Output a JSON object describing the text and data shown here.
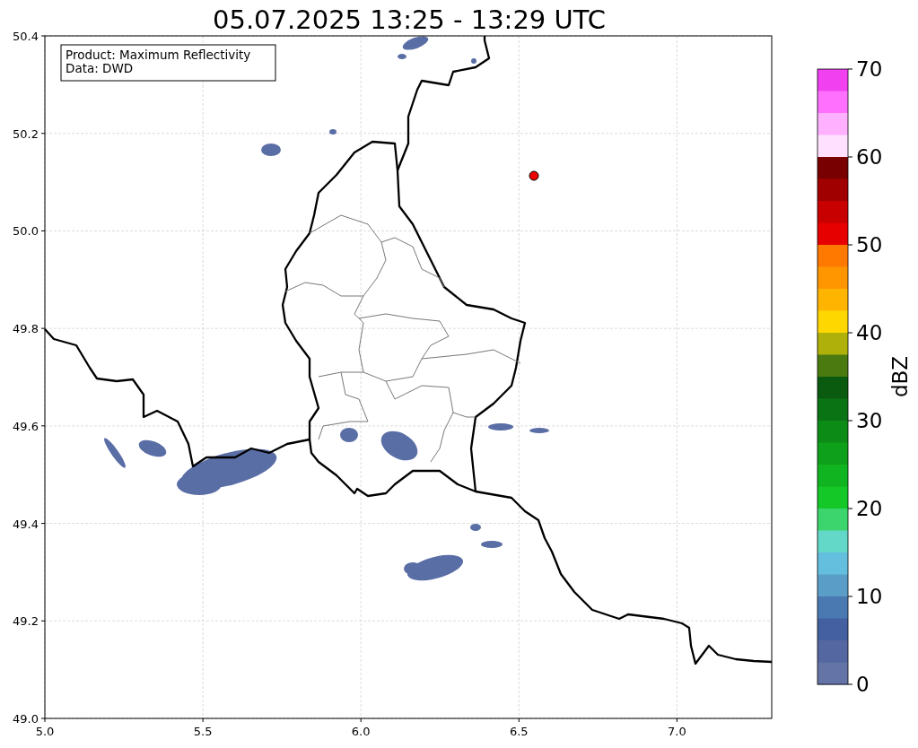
{
  "title": "05.07.2025 13:25 - 13:29 UTC",
  "info_box": {
    "lines": [
      "Product: Maximum Reflectivity",
      "Data: DWD"
    ]
  },
  "map": {
    "x_ticks": [
      "5.0",
      "5.5",
      "6.0",
      "6.5",
      "7.0"
    ],
    "y_ticks": [
      "50.4",
      "50.2",
      "50.0",
      "49.8",
      "49.6",
      "49.4",
      "49.2",
      "49.0"
    ]
  },
  "colorbar": {
    "label": "dBZ",
    "ticks": [
      "70",
      "60",
      "50",
      "40",
      "30",
      "20",
      "10",
      "0"
    ],
    "bands": [
      {
        "color": "#f040f0"
      },
      {
        "color": "#ff70ff"
      },
      {
        "color": "#ffb0ff"
      },
      {
        "color": "#ffe0ff"
      },
      {
        "color": "#780000"
      },
      {
        "color": "#a00000"
      },
      {
        "color": "#c80000"
      },
      {
        "color": "#e60000"
      },
      {
        "color": "#ff7800"
      },
      {
        "color": "#ff9600"
      },
      {
        "color": "#ffb400"
      },
      {
        "color": "#ffd700"
      },
      {
        "color": "#b0b00a"
      },
      {
        "color": "#4a7a10"
      },
      {
        "color": "#0a5a10"
      },
      {
        "color": "#0a7414"
      },
      {
        "color": "#0c8c16"
      },
      {
        "color": "#0ea01a"
      },
      {
        "color": "#10b420"
      },
      {
        "color": "#14c828"
      },
      {
        "color": "#3cd46c"
      },
      {
        "color": "#64d8c8"
      },
      {
        "color": "#64bede"
      },
      {
        "color": "#5a9ec8"
      },
      {
        "color": "#4a78b0"
      },
      {
        "color": "#4560a0"
      },
      {
        "color": "#5567a0"
      },
      {
        "color": "#6474a6"
      }
    ]
  }
}
